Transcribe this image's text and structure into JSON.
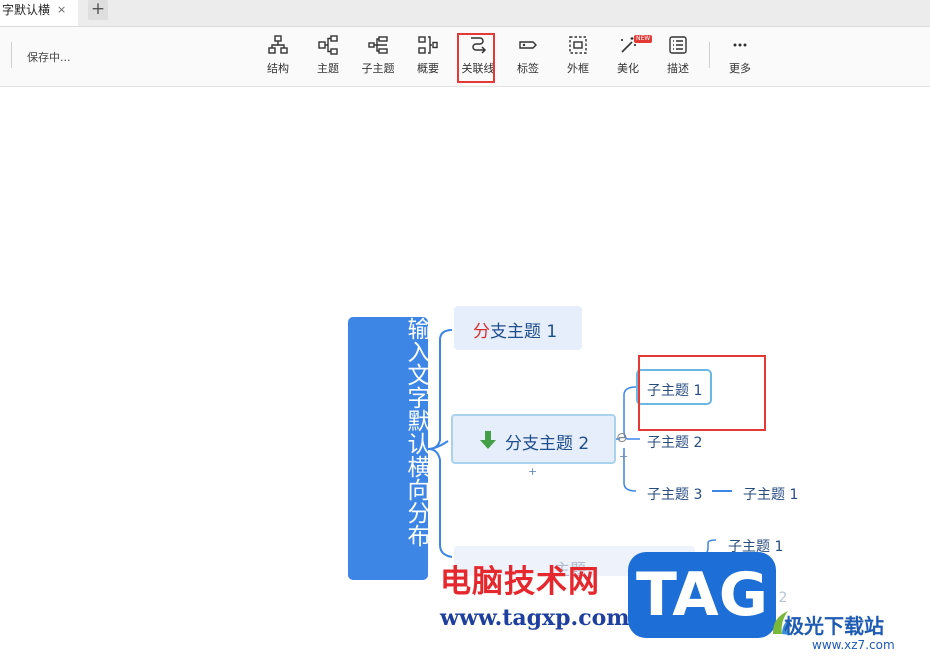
{
  "tab": {
    "title": "字默认横",
    "close": "×",
    "add": "+"
  },
  "toolbar": {
    "save_status": "保存中...",
    "items": [
      {
        "label": "结构",
        "icon": "structure-icon"
      },
      {
        "label": "主题",
        "icon": "topic-icon"
      },
      {
        "label": "子主题",
        "icon": "subtopic-icon"
      },
      {
        "label": "概要",
        "icon": "summary-icon"
      },
      {
        "label": "关联线",
        "icon": "relationship-icon"
      },
      {
        "label": "标签",
        "icon": "label-icon"
      },
      {
        "label": "外框",
        "icon": "boundary-icon"
      },
      {
        "label": "美化",
        "icon": "beautify-icon"
      },
      {
        "label": "描述",
        "icon": "description-icon"
      },
      {
        "label": "更多",
        "icon": "more-icon"
      }
    ],
    "new_badge": "NEW"
  },
  "mindmap": {
    "central": "输入文字默认横向分布",
    "branch1_prefix": "分",
    "branch1_rest": "支主题 1",
    "branch2": "分支主题 2",
    "collapse_glyph": "⊖",
    "plus_glyph": "+",
    "branch3_partial": "主题",
    "sub1": "子主题 1",
    "sub2": "子主题 2",
    "sub3": "子主题 3",
    "sub3_child": "子主题 1",
    "b3_sub1": "子主题 1",
    "b3_sub2_partial": "子主题 2"
  },
  "watermark": {
    "cn": "电脑技术网",
    "url": "www.tagxp.com",
    "tag": "TAG",
    "site_cn": "极光下载站",
    "site_url": "www.xz7.com"
  },
  "colors": {
    "accent": "#3d86e6",
    "highlight": "#e53935",
    "branch_bg": "#e6eefc"
  }
}
